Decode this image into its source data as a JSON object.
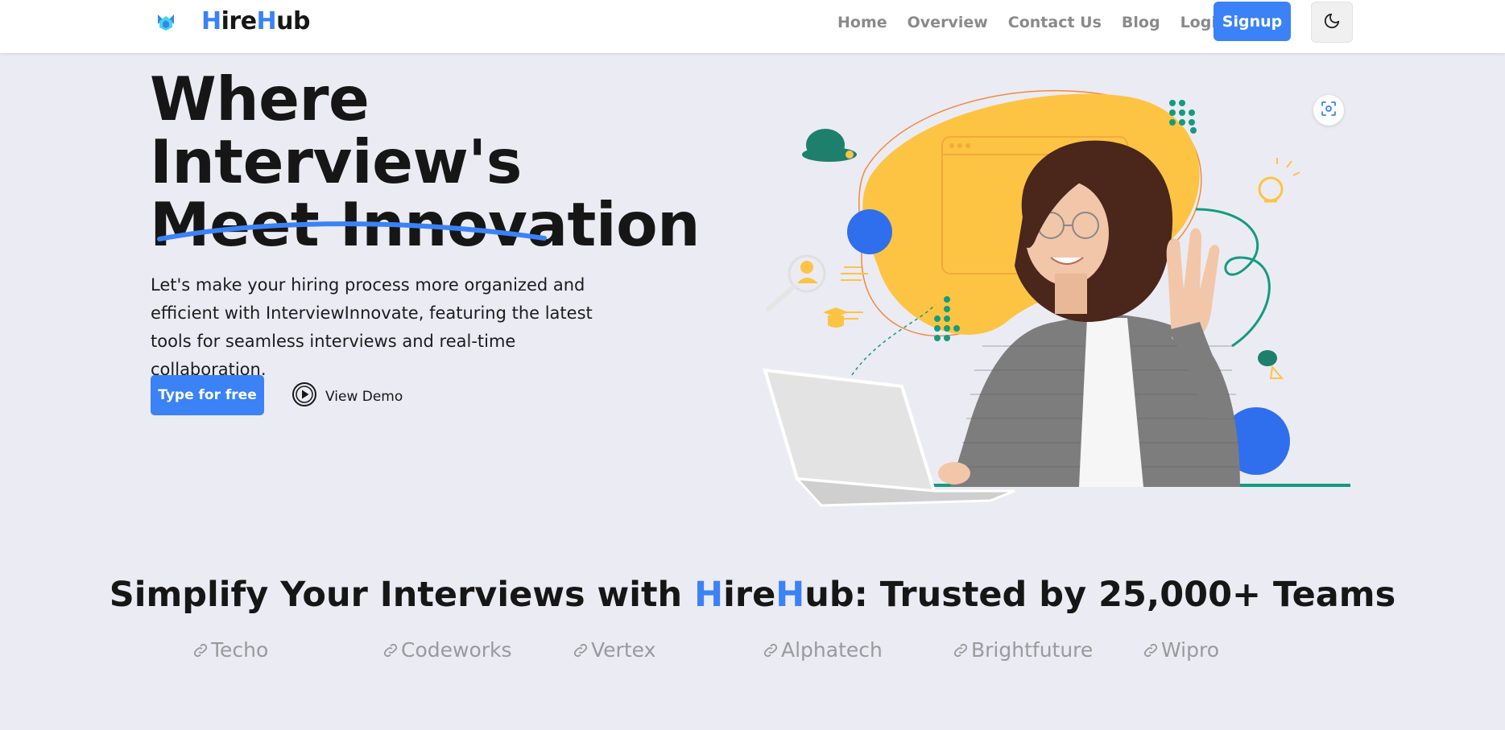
{
  "brand": {
    "part1": "H",
    "part2": "ire",
    "part3": "H",
    "part4": "ub"
  },
  "nav": {
    "links": [
      "Home",
      "Overview",
      "Contact Us",
      "Blog",
      "Login"
    ],
    "signup": "Signup"
  },
  "hero": {
    "title_line1": "Where Interview's",
    "title_line2": "Meet Innovation",
    "description": "Let's make your hiring process more organized and efficient with InterviewInnovate, featuring the latest tools for seamless interviews and real-time collaboration.",
    "cta": "Type for free",
    "demo": "View Demo"
  },
  "trusted": {
    "prefix": "Simplify Your Interviews with ",
    "brand_h1": "H",
    "brand_ire": "ire",
    "brand_h2": "H",
    "suffix": "ub: Trusted by 25,000+ Teams"
  },
  "companies": [
    "Techo",
    "Codeworks",
    "Vertex",
    "Alphatech",
    "Brightfuture",
    "Wipro"
  ],
  "colors": {
    "accent": "#3b82f6",
    "background": "#ebebf3",
    "illustration_blob": "#fdc443",
    "teal": "#1a9b84"
  },
  "icons": {
    "logo": "hirehub-logo-icon",
    "theme": "moon-icon",
    "play": "play-circle-icon",
    "focus": "focus-scan-icon",
    "company": "link-icon"
  }
}
